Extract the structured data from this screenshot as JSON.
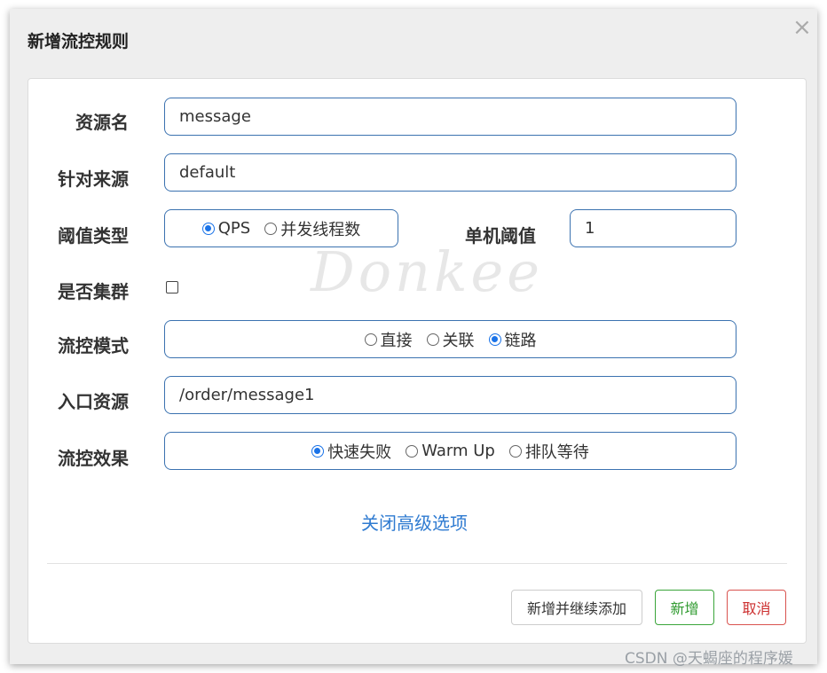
{
  "dialog": {
    "title": "新增流控规则",
    "close_glyph": "×"
  },
  "form": {
    "resource_name": {
      "label": "资源名",
      "value": "message"
    },
    "limit_app": {
      "label": "针对来源",
      "value": "default"
    },
    "grade": {
      "label": "阈值类型",
      "options": [
        {
          "label": "QPS",
          "checked": true
        },
        {
          "label": "并发线程数",
          "checked": false
        }
      ]
    },
    "threshold": {
      "label": "单机阈值",
      "value": "1"
    },
    "cluster": {
      "label": "是否集群",
      "checked": false
    },
    "strategy": {
      "label": "流控模式",
      "options": [
        {
          "label": "直接",
          "checked": false
        },
        {
          "label": "关联",
          "checked": false
        },
        {
          "label": "链路",
          "checked": true
        }
      ]
    },
    "ref_resource": {
      "label": "入口资源",
      "value": "/order/message1"
    },
    "control_behavior": {
      "label": "流控效果",
      "options": [
        {
          "label": "快速失败",
          "checked": true
        },
        {
          "label": "Warm Up",
          "checked": false
        },
        {
          "label": "排队等待",
          "checked": false
        }
      ]
    },
    "advanced_toggle": "关闭高级选项"
  },
  "footer": {
    "add_continue_label": "新增并继续添加",
    "add_label": "新增",
    "cancel_label": "取消"
  },
  "overlay": {
    "watermark_logo": "Donkee",
    "csdn_watermark": "CSDN @天蝎座的程序媛"
  },
  "colors": {
    "accent": "#1a73e8",
    "input_border": "#3b72b0",
    "success": "#3aa53a",
    "danger": "#d9534f",
    "link": "#2f7bd1"
  }
}
